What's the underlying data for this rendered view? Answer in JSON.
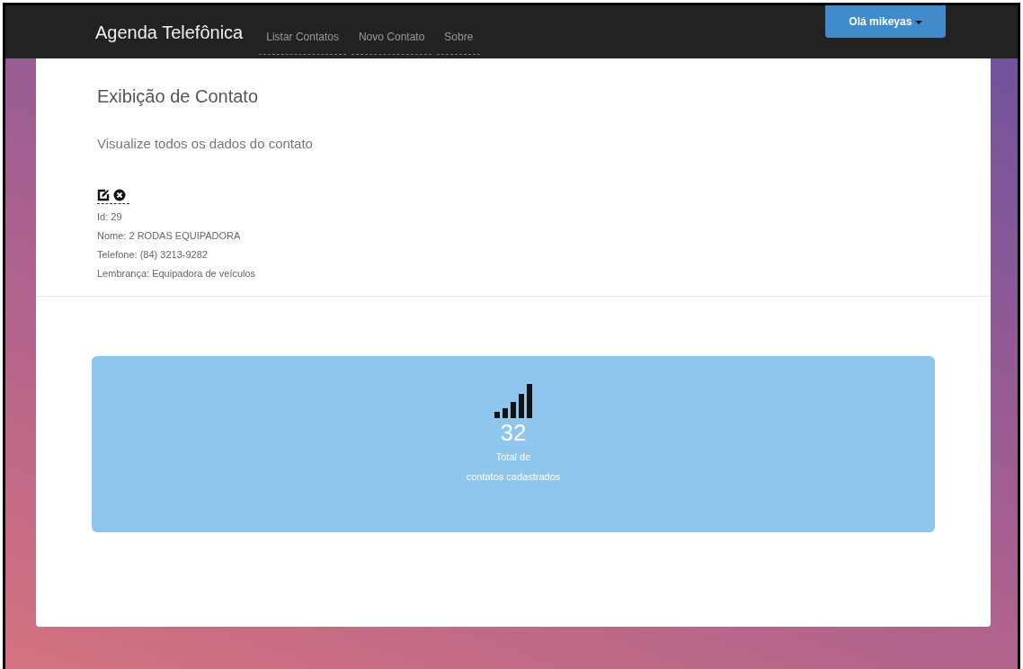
{
  "navbar": {
    "brand": "Agenda Telefônica",
    "links": [
      {
        "label": "Listar Contatos"
      },
      {
        "label": "Novo Contato"
      },
      {
        "label": "Sobre"
      }
    ],
    "user_button": "Olá mikeyas"
  },
  "header": {
    "title": "Exibição de Contato",
    "subtitle": "Visualize todos os dados do contato"
  },
  "contact": {
    "fields": [
      "Id: 29",
      "Nome: 2 RODAS EQUIPADORA",
      "Telefone: (84) 3213-9282",
      "Lembrança: Equipadora de veículos"
    ]
  },
  "stats": {
    "count": "32",
    "caption_lines": [
      "Total de",
      "contatos cadastrados"
    ]
  }
}
